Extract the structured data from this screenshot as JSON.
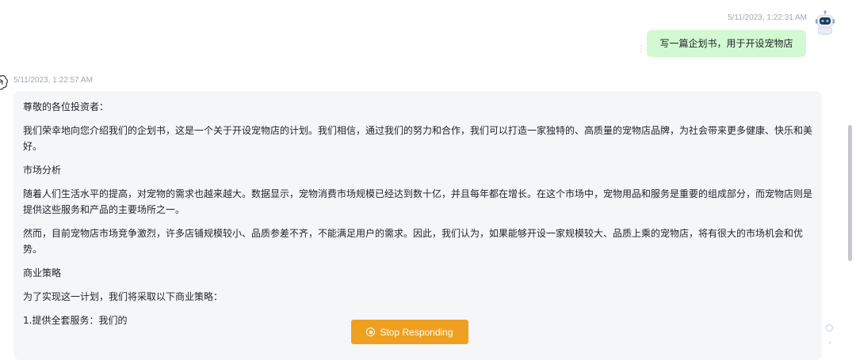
{
  "user_message": {
    "timestamp": "5/11/2023, 1:22:31 AM",
    "text": "写一篇企划书，用于开设宠物店"
  },
  "bot_message": {
    "timestamp": "5/11/2023, 1:22:57 AM",
    "paragraphs": [
      "尊敬的各位投资者：",
      "我们荣幸地向您介绍我们的企划书，这是一个关于开设宠物店的计划。我们相信，通过我们的努力和合作，我们可以打造一家独特的、高质量的宠物店品牌，为社会带来更多健康、快乐和美好。",
      "市场分析",
      "随着人们生活水平的提高，对宠物的需求也越来越大。数据显示，宠物消费市场规模已经达到数十亿，并且每年都在增长。在这个市场中，宠物用品和服务是重要的组成部分，而宠物店则是提供这些服务和产品的主要场所之一。",
      "然而，目前宠物店市场竞争激烈，许多店铺规模较小、品质参差不齐，不能满足用户的需求。因此，我们认为，如果能够开设一家规模较大、品质上乘的宠物店，将有很大的市场机会和优势。",
      "商业策略",
      "为了实现这一计划，我们将采取以下商业策略：",
      "1.提供全套服务：我们的"
    ]
  },
  "stop_button": {
    "label": "Stop Responding"
  },
  "icons": {
    "user_avatar": "robot-avatar-icon",
    "bot_avatar": "openai-logo-icon",
    "more": "vertical-dots-icon",
    "stop": "stop-circle-icon"
  },
  "colors": {
    "user_bubble": "#d2f9d1",
    "bot_bubble": "#f4f6f8",
    "stop_button": "#f0a020"
  }
}
